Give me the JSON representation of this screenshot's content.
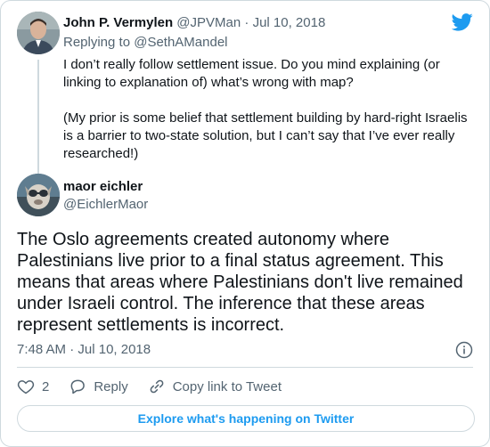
{
  "parent_tweet": {
    "author_name": "John P. Vermylen",
    "handle": "@JPVMan",
    "separator": "·",
    "date": "Jul 10, 2018",
    "replying_to_prefix": "Replying to",
    "replying_to_handle": "@SethAMandel",
    "paragraphs": [
      "I don’t really follow settlement issue. Do you mind explaining (or linking to explanation of) what’s wrong with map?",
      "(My prior is some belief that settlement building by hard-right Israelis is a barrier to two-state solution, but I can’t say that I’ve ever really researched!)"
    ]
  },
  "main_tweet": {
    "author_name": "maor eichler",
    "handle": "@EichlerMaor",
    "text": "The Oslo agreements created autonomy where Palestinians live prior to a final status agreement. This means that areas where Palestinians don't live remained under Israeli control. The inference that these areas represent settlements is incorrect.",
    "time": "7:48 AM",
    "separator": "·",
    "date": "Jul 10, 2018"
  },
  "actions": {
    "like_count": "2",
    "reply_label": "Reply",
    "copy_link_label": "Copy link to Tweet"
  },
  "explore_label": "Explore what's happening on Twitter",
  "icons": {
    "brand": "twitter-bird-icon",
    "info": "info-icon",
    "like": "heart-icon",
    "reply": "speech-bubble-icon",
    "copy_link": "link-icon"
  },
  "colors": {
    "brand_blue": "#1d9bf0",
    "text": "#0f1419",
    "secondary": "#536471",
    "border": "#cfd9de"
  }
}
